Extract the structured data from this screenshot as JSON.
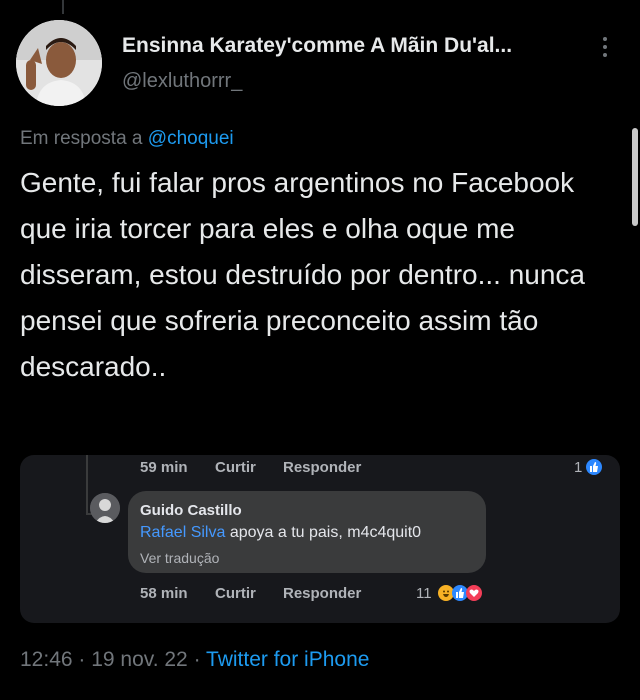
{
  "author": {
    "display_name": "Ensinna Karatey'comme A Mãin Du'al...",
    "handle": "@lexluthorrr_"
  },
  "reply": {
    "prefix": "Em resposta a ",
    "mention": "@choquei"
  },
  "tweet": {
    "text": "Gente, fui falar pros argentinos no Facebook que iria torcer para eles e olha oque me disseram, estou destruído por dentro... nunca pensei que sofreria preconceito assim tão descarado.."
  },
  "embedded_screenshot": {
    "top_meta": {
      "time": "59 min",
      "like": "Curtir",
      "reply": "Responder",
      "reaction_count": "1"
    },
    "comment": {
      "author": "Guido Castillo",
      "tag": "Rafael Silva",
      "text": " apoya a tu pais, m4c4quit0",
      "see_translation": "Ver tradução"
    },
    "bottom_meta": {
      "time": "58 min",
      "like": "Curtir",
      "reply": "Responder",
      "reaction_count": "11"
    },
    "colors": {
      "like": "#2d88ff",
      "haha": "#f7b125",
      "love": "#f33e58",
      "tag": "#4599ff"
    }
  },
  "footer": {
    "time_date": "12:46 · 19 nov. 22 · ",
    "source": "Twitter for iPhone"
  },
  "colors": {
    "accent": "#1d9bf0",
    "muted": "#71767b",
    "text": "#e7e9ea",
    "background": "#000000"
  }
}
